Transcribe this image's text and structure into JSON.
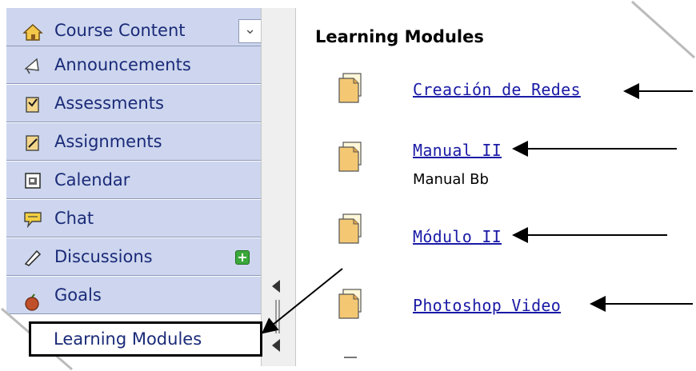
{
  "sidebar": {
    "items": [
      {
        "label": "Course Content",
        "icon": "home-icon"
      },
      {
        "label": "Announcements",
        "icon": "megaphone-icon"
      },
      {
        "label": "Assessments",
        "icon": "assessment-icon"
      },
      {
        "label": "Assignments",
        "icon": "assignment-icon"
      },
      {
        "label": "Calendar",
        "icon": "calendar-icon"
      },
      {
        "label": "Chat",
        "icon": "chat-icon"
      },
      {
        "label": "Discussions",
        "icon": "discussion-icon"
      },
      {
        "label": "Goals",
        "icon": "apple-icon"
      },
      {
        "label": "Learning Modules",
        "icon": "none"
      }
    ],
    "selected": "Learning Modules"
  },
  "main": {
    "title": "Learning Modules",
    "modules": [
      {
        "link": "Creación de Redes",
        "description": ""
      },
      {
        "link": "Manual II",
        "description": "Manual Bb"
      },
      {
        "link": "Módulo II",
        "description": ""
      },
      {
        "link": "Photoshop Video",
        "description": ""
      }
    ]
  },
  "colors": {
    "menu_bg": "#cdd6ee",
    "menu_text": "#1a2a78",
    "link": "#1a1aa6"
  }
}
